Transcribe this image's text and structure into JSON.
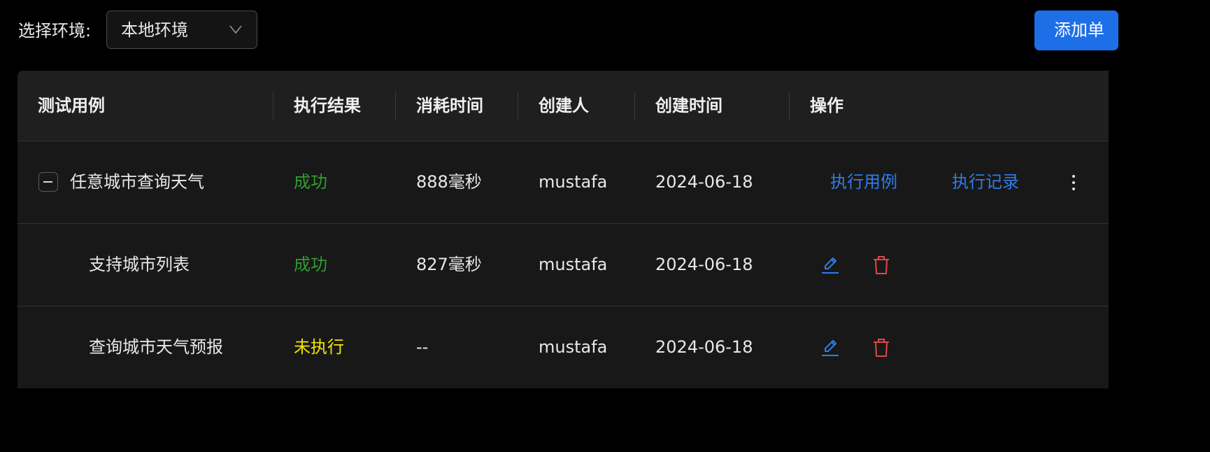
{
  "toolbar": {
    "env_label": "选择环境:",
    "env_selected": "本地环境",
    "add_button_label": "添加单"
  },
  "table": {
    "headers": [
      "测试用例",
      "执行结果",
      "消耗时间",
      "创建人",
      "创建时间",
      "操作"
    ],
    "rows": [
      {
        "name": "任意城市查询天气",
        "result": "成功",
        "duration": "888毫秒",
        "creator": "mustafa",
        "created": "2024-06-18",
        "actions": {
          "run": "执行用例",
          "history": "执行记录",
          "more_icon": "more-vertical-icon"
        }
      },
      {
        "name": "支持城市列表",
        "result": "成功",
        "duration": "827毫秒",
        "creator": "mustafa",
        "created": "2024-06-18",
        "actions": {
          "edit_icon": "edit-icon",
          "delete_icon": "trash-icon"
        }
      },
      {
        "name": "查询城市天气预报",
        "result": "未执行",
        "duration": "--",
        "creator": "mustafa",
        "created": "2024-06-18",
        "actions": {
          "edit_icon": "edit-icon",
          "delete_icon": "trash-icon"
        }
      }
    ]
  },
  "colors": {
    "primary": "#1d6fe8",
    "link": "#2f7ce9",
    "success": "#2f9e2f",
    "pending": "#f2e600",
    "danger": "#e0484a"
  }
}
